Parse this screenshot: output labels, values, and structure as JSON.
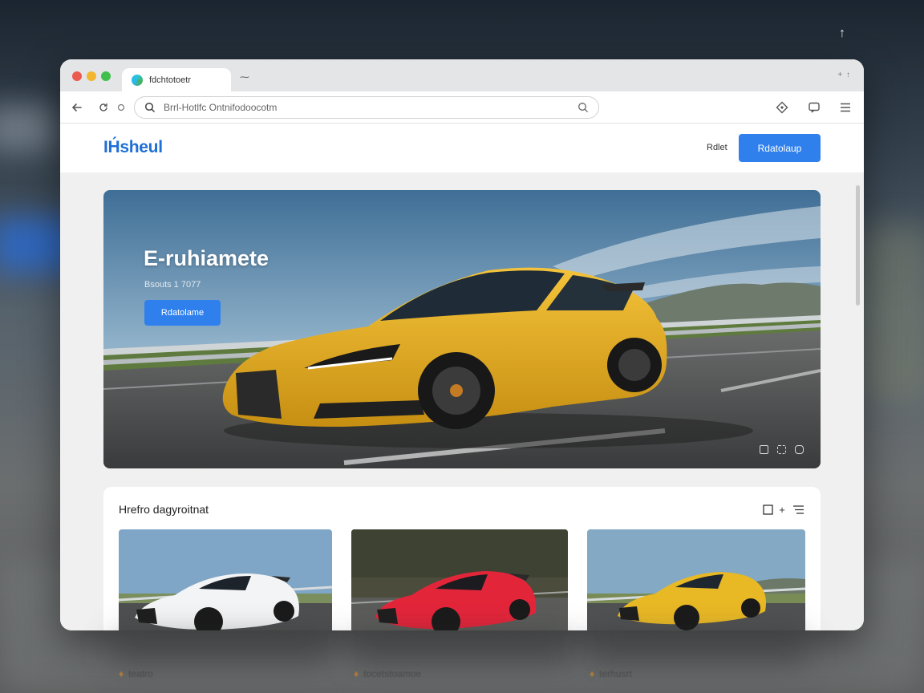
{
  "browser": {
    "tab_title": "fdchtotoetr",
    "new_tab_symbol": "⁓",
    "address": "Brrl-Hotlfc Ontnifodoocotm",
    "window_controls_right": "+ ↑"
  },
  "site": {
    "logo": "IH́sheul",
    "nav_link": "Rdlet",
    "cta_label": "Rdatolaup"
  },
  "hero": {
    "title": "E-ruhiamete",
    "subtitle": "Bsouts 1 7077",
    "button_label": "Rdatolame"
  },
  "gallery": {
    "title": "Hrefro dagyroitnat",
    "cards": [
      {
        "name": "white-car",
        "label": "teatro",
        "car_color": "#f4f5f6"
      },
      {
        "name": "red-car",
        "label": "tocetstoamoe",
        "car_color": "#e3253a"
      },
      {
        "name": "yellow-car",
        "label": "terhusrt",
        "car_color": "#e8b825"
      }
    ]
  },
  "colors": {
    "accent": "#2f80ed",
    "hero_car": "#e9b52a"
  }
}
